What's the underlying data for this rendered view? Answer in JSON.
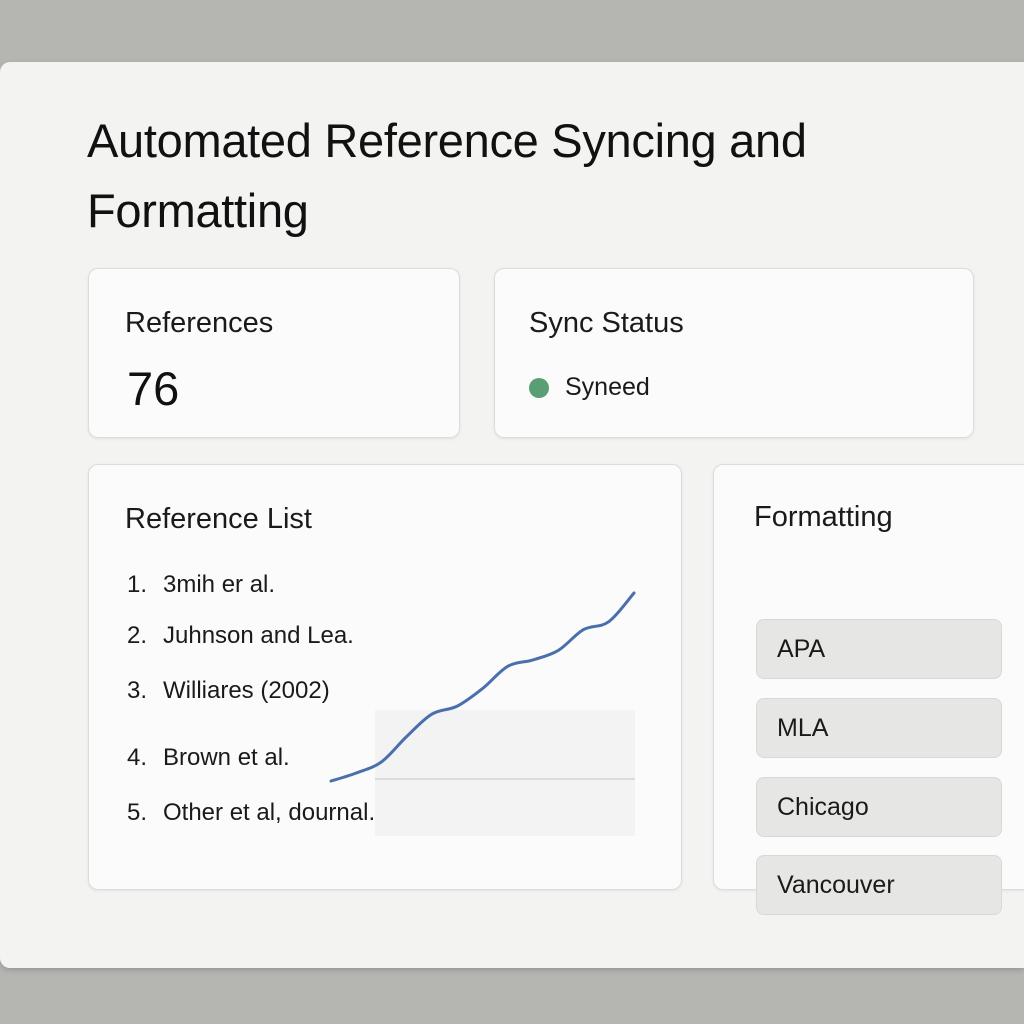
{
  "header": {
    "title": "Automated Reference Syncing and Formatting"
  },
  "references_card": {
    "title": "References",
    "count": "76"
  },
  "sync_card": {
    "title": "Sync Status",
    "status": "Syneed",
    "status_color": "#5a9e73"
  },
  "reference_list": {
    "title": "Reference List",
    "items": [
      {
        "number": "1.",
        "text": "3mih er al."
      },
      {
        "number": "2.",
        "text": "Juhnson and Lea."
      },
      {
        "number": "3.",
        "text": "Williares (2002)"
      },
      {
        "number": "4.",
        "text": "Brown et al."
      },
      {
        "number": "5.",
        "text": "Other et al, dournal."
      }
    ],
    "sparkline": {
      "color": "#4a6fad",
      "values": [
        0.0,
        0.05,
        0.12,
        0.28,
        0.42,
        0.47,
        0.58,
        0.72,
        0.76,
        0.82,
        0.95,
        1.0,
        1.18
      ]
    }
  },
  "formatting": {
    "title": "Formatting",
    "options": [
      "APA",
      "MLA",
      "Chicago",
      "Vancouver"
    ]
  }
}
